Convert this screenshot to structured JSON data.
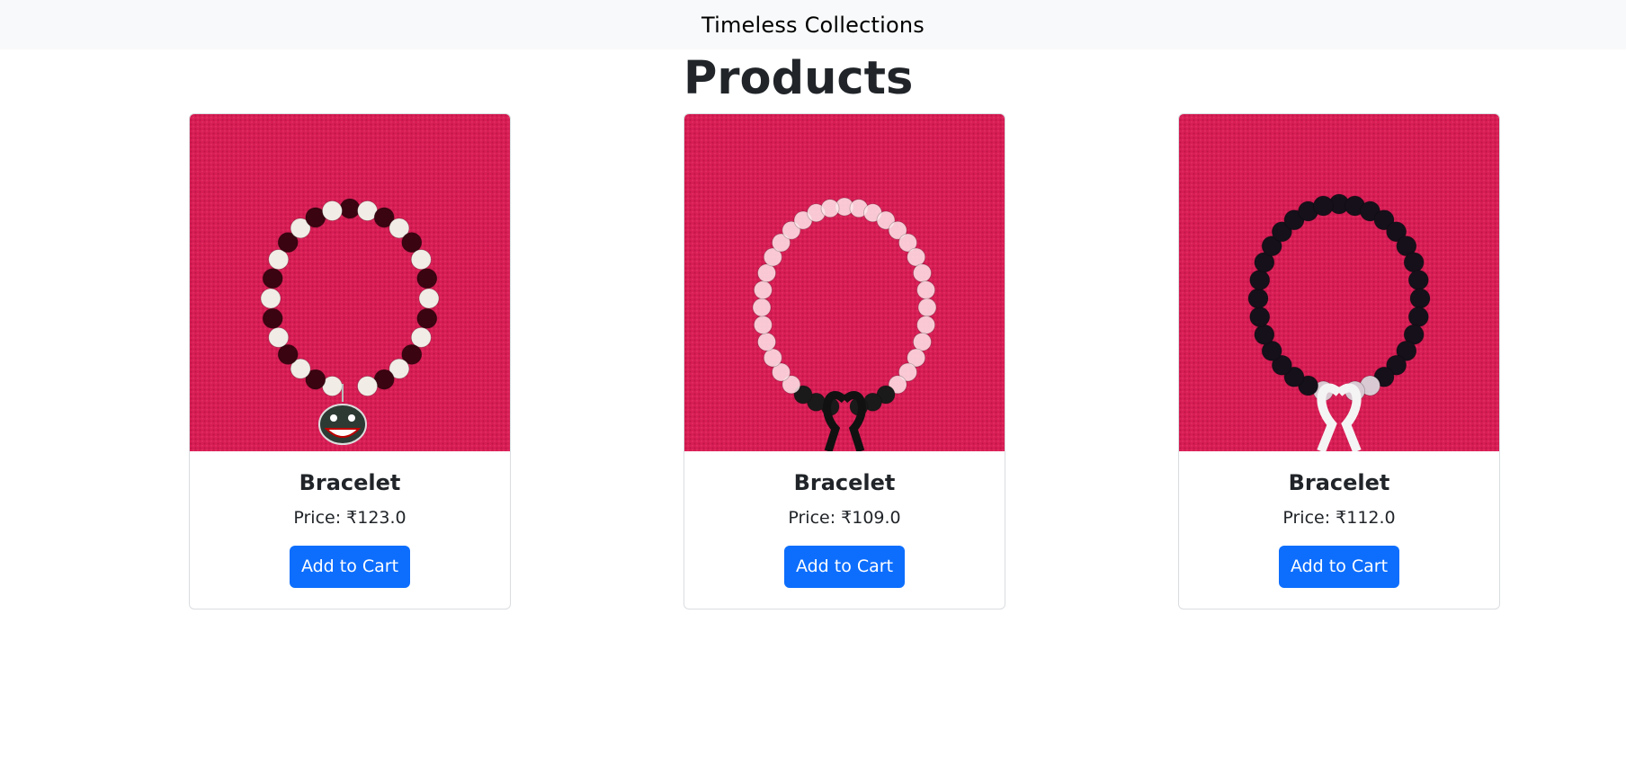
{
  "navbar": {
    "brand": "Timeless Collections"
  },
  "page": {
    "heading": "Products"
  },
  "products": [
    {
      "name": "Bracelet",
      "price": "Price: ₹123.0",
      "button": "Add to Cart",
      "charm": "shark"
    },
    {
      "name": "Bracelet",
      "price": "Price: ₹109.0",
      "button": "Add to Cart",
      "charm": "black-ribbon"
    },
    {
      "name": "Bracelet",
      "price": "Price: ₹112.0",
      "button": "Add to Cart",
      "charm": "white-ribbon"
    }
  ],
  "colors": {
    "accent": "#0d6efd",
    "navbar_bg": "#f8f9fa",
    "photo_bg": "#d81e55"
  }
}
